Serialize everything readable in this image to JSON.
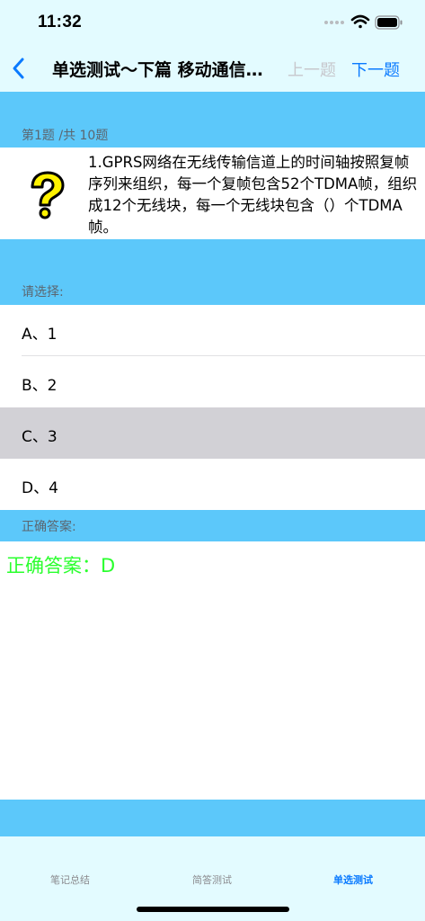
{
  "status": {
    "time": "11:32"
  },
  "nav": {
    "title": "单选测试～下篇 移动通信…",
    "prev_label": "上一题",
    "next_label": "下一题"
  },
  "question": {
    "counter": "第1题 /共 10题",
    "text": "1.GPRS网络在无线传输信道上的时间轴按照复帧序列来组织，每一个复帧包含52个TDMA帧，组织成12个无线块，每一个无线块包含（）个TDMA帧。"
  },
  "choose_label": "请选择:",
  "options": [
    {
      "label": "A、1",
      "selected": false
    },
    {
      "label": "B、2",
      "selected": false
    },
    {
      "label": "C、3",
      "selected": true
    },
    {
      "label": "D、4",
      "selected": false
    }
  ],
  "answer_header": "正确答案:",
  "answer_text": "正确答案：D",
  "tabs": [
    {
      "label": "笔记总结",
      "active": false
    },
    {
      "label": "简答测试",
      "active": false
    },
    {
      "label": "单选测试",
      "active": true
    }
  ],
  "colors": {
    "accent": "#0a7aff",
    "band": "#5cc8fa",
    "header_bg": "#e3fbff",
    "answer": "#2aff2e",
    "selected_row": "#d2d1d6"
  }
}
